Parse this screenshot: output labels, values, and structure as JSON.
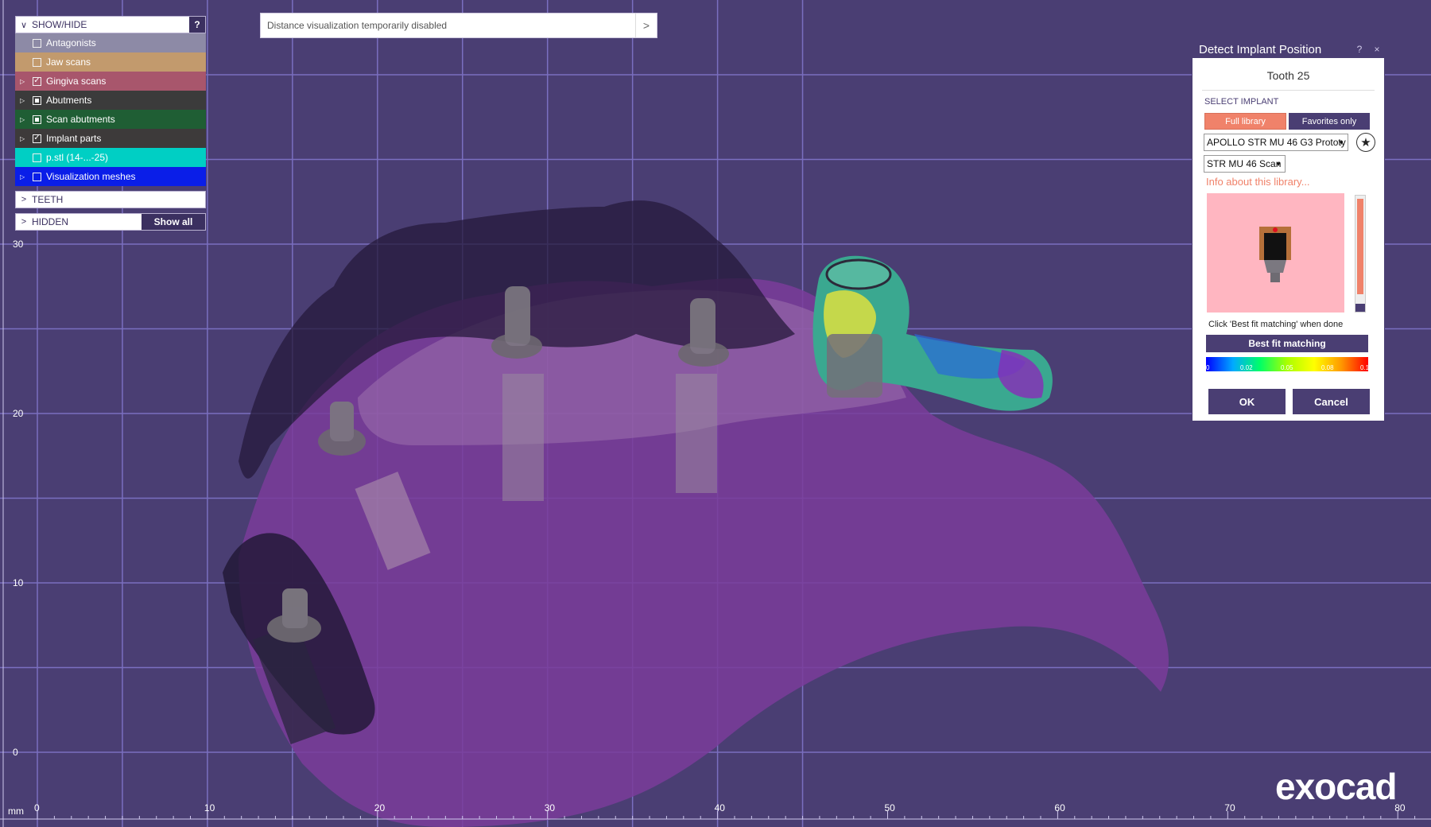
{
  "show_hide": {
    "header_label": "SHOW/HIDE",
    "help_label": "?",
    "items": [
      {
        "label": "Antagonists",
        "checked": "none",
        "has_children": false,
        "color": "#8d8aa6"
      },
      {
        "label": "Jaw scans",
        "checked": "none",
        "has_children": false,
        "color": "#c29a6d"
      },
      {
        "label": "Gingiva scans",
        "checked": "checked",
        "has_children": true,
        "color": "#a8566c"
      },
      {
        "label": "Abutments",
        "checked": "partial",
        "has_children": true,
        "color": "#3b3b3b"
      },
      {
        "label": "Scan abutments",
        "checked": "partial",
        "has_children": true,
        "color": "#1f5e34"
      },
      {
        "label": "Implant parts",
        "checked": "checked",
        "has_children": true,
        "color": "#3d3a3a"
      },
      {
        "label": "p.stl (14-...-25)",
        "checked": "none",
        "has_children": false,
        "color": "#00cfc4"
      },
      {
        "label": "Visualization meshes",
        "checked": "none",
        "has_children": true,
        "color": "#0a1ee8"
      }
    ],
    "teeth_label": "TEETH",
    "hidden_label": "HIDDEN",
    "show_all_label": "Show all"
  },
  "notice": {
    "text": "Distance visualization temporarily disabled",
    "arrow": ">"
  },
  "dialog": {
    "title": "Detect Implant Position",
    "help": "?",
    "close": "×",
    "tooth": "Tooth 25",
    "select_label": "SELECT IMPLANT",
    "full_library": "Full library",
    "favorites_only": "Favorites only",
    "library_dropdown": "APOLLO STR MU 46 G3 Prototy",
    "implant_dropdown": "STR MU 46 Scan",
    "info_link": "Info about this library...",
    "hint": "Click 'Best fit matching' when done",
    "best_fit": "Best fit matching",
    "colorbar_ticks": [
      "0",
      "0.02",
      "0.05",
      "0.08",
      "0.1"
    ],
    "ok": "OK",
    "cancel": "Cancel",
    "accent_color": "#f0826a",
    "primary_color": "#4a3e73",
    "preview_bg": "#ffb6c1",
    "slider_level": 0.92
  },
  "viewport": {
    "unit": "mm",
    "x_ticks": [
      "0",
      "10",
      "20",
      "30",
      "40",
      "50",
      "60",
      "70",
      "80"
    ],
    "y_ticks": [
      "30",
      "20",
      "10",
      "0"
    ],
    "background": "#4a3e73",
    "grid_color": "#7a6fc0"
  },
  "brand": {
    "logo": "exocad"
  }
}
